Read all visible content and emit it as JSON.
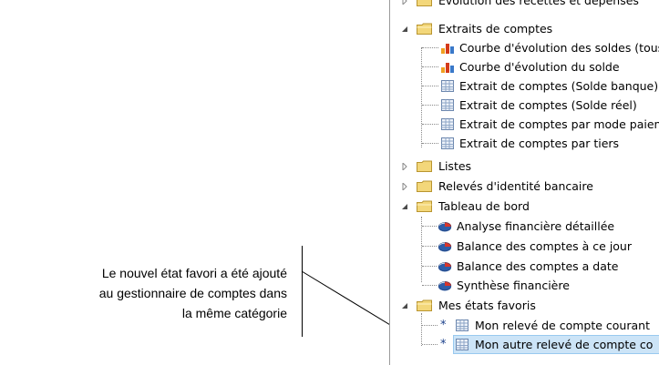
{
  "callout": {
    "lines": [
      "Le nouvel état favori a été ajouté",
      "au gestionnaire de comptes dans",
      "la même catégorie"
    ]
  },
  "tree": {
    "partial_top": "Évolution des recettes et dépenses",
    "extraits": {
      "label": "Extraits de comptes",
      "items": [
        {
          "label": "Courbe d'évolution des soldes (tous",
          "icon": "bar-chart-icon"
        },
        {
          "label": "Courbe d'évolution du solde",
          "icon": "bar-chart-icon"
        },
        {
          "label": "Extrait de comptes (Solde banque)",
          "icon": "table-report-icon"
        },
        {
          "label": "Extrait de comptes (Solde réel)",
          "icon": "table-report-icon"
        },
        {
          "label": "Extrait de comptes par mode paien",
          "icon": "table-report-icon"
        },
        {
          "label": "Extrait de comptes par tiers",
          "icon": "table-report-icon"
        }
      ]
    },
    "listes": "Listes",
    "rib": "Relevés d'identité bancaire",
    "tableau": {
      "label": "Tableau de bord",
      "items": [
        {
          "label": "Analyse financière détaillée",
          "icon": "pie-chart-icon"
        },
        {
          "label": "Balance des comptes à ce jour",
          "icon": "pie-chart-icon"
        },
        {
          "label": "Balance des comptes a date",
          "icon": "pie-chart-icon"
        },
        {
          "label": "Synthèse financière",
          "icon": "pie-chart-icon"
        }
      ]
    },
    "favoris": {
      "label": "Mes états favoris",
      "items": [
        {
          "label": "Mon relevé de compte courant",
          "icon": "table-report-icon",
          "star": "*"
        },
        {
          "label": "Mon autre relevé de compte co",
          "icon": "table-report-icon",
          "star": "*",
          "selected": true
        }
      ]
    }
  },
  "colors": {
    "folder": "#e8c45c",
    "selection": "#cce4f7",
    "star": "#1a3f8a"
  }
}
